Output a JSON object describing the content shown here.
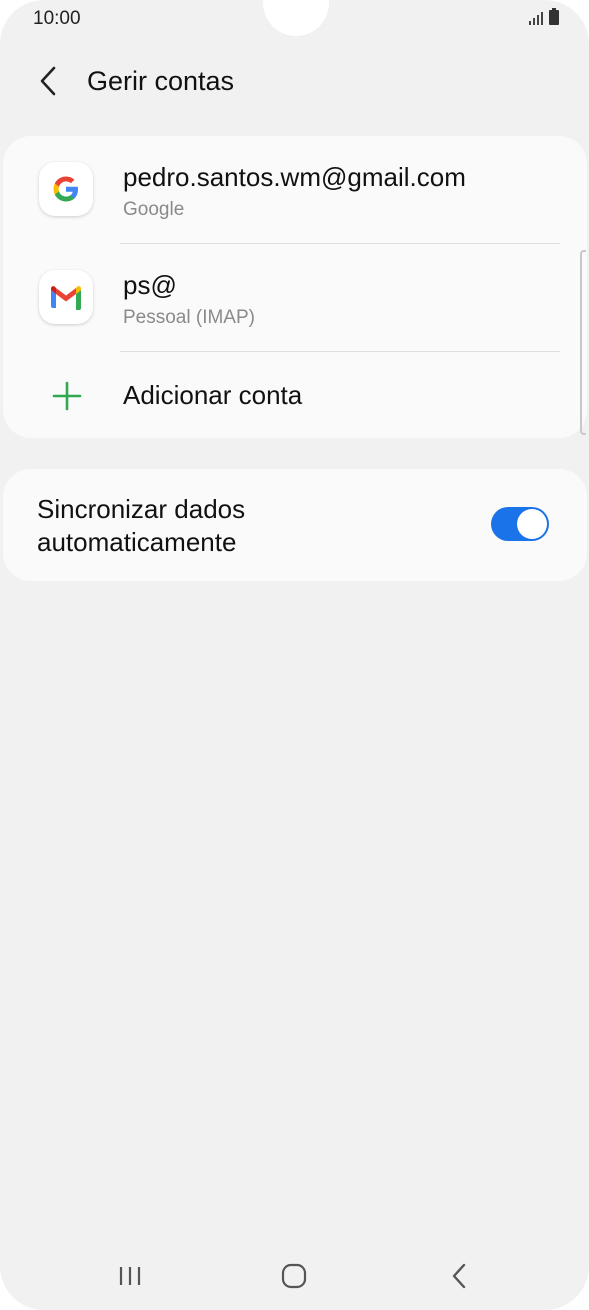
{
  "status_bar": {
    "time": "10:00"
  },
  "header": {
    "title": "Gerir contas",
    "back_icon": "chevron-left-icon"
  },
  "accounts": [
    {
      "title": "pedro.santos.wm@gmail.com",
      "subtitle": "Google",
      "icon": "google-icon"
    },
    {
      "title": "ps@",
      "subtitle": "Pessoal (IMAP)",
      "icon": "gmail-icon"
    }
  ],
  "add_account": {
    "label": "Adicionar conta",
    "icon": "plus-icon",
    "icon_color": "#2fa84f"
  },
  "sync": {
    "label": "Sincronizar dados automaticamente",
    "enabled": true,
    "accent": "#1a73e8"
  },
  "nav_bar": {
    "recents_icon": "recents-icon",
    "home_icon": "home-icon",
    "back_icon": "back-nav-icon"
  }
}
